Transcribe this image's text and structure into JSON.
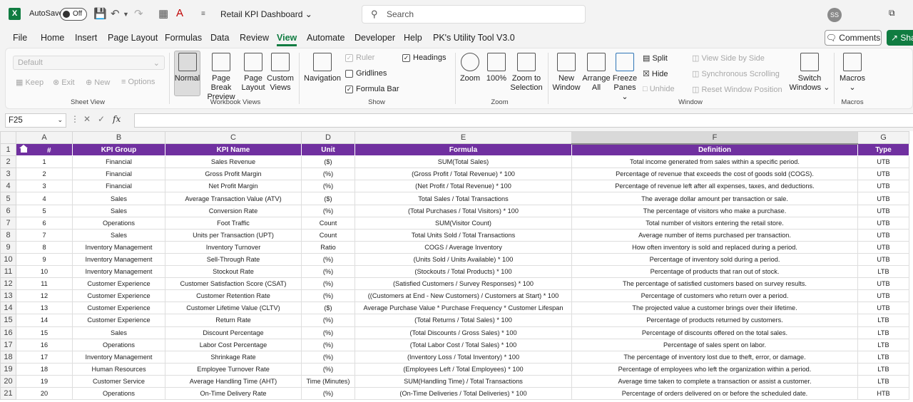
{
  "titlebar": {
    "app_icon": "X",
    "autosave_label": "AutoSave",
    "autosave_state": "Off",
    "doc_title": "Retail KPI Dashboard",
    "search_placeholder": "Search",
    "avatar": "SS"
  },
  "menu": {
    "items": [
      "File",
      "Home",
      "Insert",
      "Page Layout",
      "Formulas",
      "Data",
      "Review",
      "View",
      "Automate",
      "Developer",
      "Help",
      "PK's Utility Tool V3.0"
    ],
    "active": "View",
    "comments": "Comments",
    "share": "Sha"
  },
  "ribbon": {
    "sheet_view": {
      "dropdown": "Default",
      "keep": "Keep",
      "exit": "Exit",
      "new": "New",
      "options": "Options",
      "label": "Sheet View"
    },
    "workbook_views": {
      "normal": "Normal",
      "page_break_1": "Page Break",
      "page_break_2": "Preview",
      "page_layout_1": "Page",
      "page_layout_2": "Layout",
      "custom_1": "Custom",
      "custom_2": "Views",
      "label": "Workbook Views"
    },
    "show": {
      "navigation": "Navigation",
      "ruler": "Ruler",
      "gridlines": "Gridlines",
      "formula_bar": "Formula Bar",
      "headings": "Headings",
      "label": "Show"
    },
    "zoom": {
      "zoom": "Zoom",
      "hundred": "100%",
      "zoom_sel_1": "Zoom to",
      "zoom_sel_2": "Selection",
      "label": "Zoom"
    },
    "window": {
      "new_1": "New",
      "new_2": "Window",
      "arrange_1": "Arrange",
      "arrange_2": "All",
      "freeze_1": "Freeze",
      "freeze_2": "Panes",
      "split": "Split",
      "hide": "Hide",
      "unhide": "Unhide",
      "side_by_side": "View Side by Side",
      "sync_scroll": "Synchronous Scrolling",
      "reset_pos": "Reset Window Position",
      "switch_1": "Switch",
      "switch_2": "Windows",
      "label": "Window"
    },
    "macros": {
      "macros": "Macros",
      "label": "Macros"
    }
  },
  "formula_bar": {
    "name_box": "F25",
    "fx": "fx",
    "value": ""
  },
  "sheet": {
    "columns": [
      "A",
      "B",
      "C",
      "D",
      "E",
      "F",
      "G"
    ],
    "headers": [
      "#",
      "KPI Group",
      "KPI Name",
      "Unit",
      "Formula",
      "Definition",
      "Type"
    ],
    "rows": [
      [
        "1",
        "Financial",
        "Sales Revenue",
        "($)",
        "SUM(Total Sales)",
        "Total income generated from sales within a specific period.",
        "UTB"
      ],
      [
        "2",
        "Financial",
        "Gross Profit Margin",
        "(%)",
        "(Gross Profit / Total Revenue) * 100",
        "Percentage of revenue that exceeds the cost of goods sold (COGS).",
        "UTB"
      ],
      [
        "3",
        "Financial",
        "Net Profit Margin",
        "(%)",
        "(Net Profit / Total Revenue) * 100",
        "Percentage of revenue left after all expenses, taxes, and deductions.",
        "UTB"
      ],
      [
        "4",
        "Sales",
        "Average Transaction Value (ATV)",
        "($)",
        "Total Sales / Total Transactions",
        "The average dollar amount per transaction or sale.",
        "UTB"
      ],
      [
        "5",
        "Sales",
        "Conversion Rate",
        "(%)",
        "(Total Purchases / Total Visitors) * 100",
        "The percentage of visitors who make a purchase.",
        "UTB"
      ],
      [
        "6",
        "Operations",
        "Foot Traffic",
        "Count",
        "SUM(Visitor Count)",
        "Total number of visitors entering the retail store.",
        "UTB"
      ],
      [
        "7",
        "Sales",
        "Units per Transaction (UPT)",
        "Count",
        "Total Units Sold / Total Transactions",
        "Average number of items purchased per transaction.",
        "UTB"
      ],
      [
        "8",
        "Inventory Management",
        "Inventory Turnover",
        "Ratio",
        "COGS / Average Inventory",
        "How often inventory is sold and replaced during a period.",
        "UTB"
      ],
      [
        "9",
        "Inventory Management",
        "Sell-Through Rate",
        "(%)",
        "(Units Sold / Units Available) * 100",
        "Percentage of inventory sold during a period.",
        "UTB"
      ],
      [
        "10",
        "Inventory Management",
        "Stockout Rate",
        "(%)",
        "(Stockouts / Total Products) * 100",
        "Percentage of products that ran out of stock.",
        "LTB"
      ],
      [
        "11",
        "Customer Experience",
        "Customer Satisfaction Score (CSAT)",
        "(%)",
        "(Satisfied Customers / Survey Responses) * 100",
        "The percentage of satisfied customers based on survey results.",
        "UTB"
      ],
      [
        "12",
        "Customer Experience",
        "Customer Retention Rate",
        "(%)",
        "((Customers at End - New Customers) / Customers at Start) * 100",
        "Percentage of customers who return over a period.",
        "UTB"
      ],
      [
        "13",
        "Customer Experience",
        "Customer Lifetime Value (CLTV)",
        "($)",
        "Average Purchase Value * Purchase Frequency * Customer Lifespan",
        "The projected value a customer brings over their lifetime.",
        "UTB"
      ],
      [
        "14",
        "Customer Experience",
        "Return Rate",
        "(%)",
        "(Total Returns / Total Sales) * 100",
        "Percentage of products returned by customers.",
        "LTB"
      ],
      [
        "15",
        "Sales",
        "Discount Percentage",
        "(%)",
        "(Total Discounts / Gross Sales) * 100",
        "Percentage of discounts offered on the total sales.",
        "LTB"
      ],
      [
        "16",
        "Operations",
        "Labor Cost Percentage",
        "(%)",
        "(Total Labor Cost / Total Sales) * 100",
        "Percentage of sales spent on labor.",
        "LTB"
      ],
      [
        "17",
        "Inventory Management",
        "Shrinkage Rate",
        "(%)",
        "(Inventory Loss / Total Inventory) * 100",
        "The percentage of inventory lost due to theft, error, or damage.",
        "LTB"
      ],
      [
        "18",
        "Human Resources",
        "Employee Turnover Rate",
        "(%)",
        "(Employees Left / Total Employees) * 100",
        "Percentage of employees who left the organization within a period.",
        "LTB"
      ],
      [
        "19",
        "Customer Service",
        "Average Handling Time (AHT)",
        "Time (Minutes)",
        "SUM(Handling Time) / Total Transactions",
        "Average time taken to complete a transaction or assist a customer.",
        "LTB"
      ],
      [
        "20",
        "Operations",
        "On-Time Delivery Rate",
        "(%)",
        "(On-Time Deliveries / Total Deliveries) * 100",
        "Percentage of orders delivered on or before the scheduled date.",
        "HTB"
      ]
    ]
  }
}
